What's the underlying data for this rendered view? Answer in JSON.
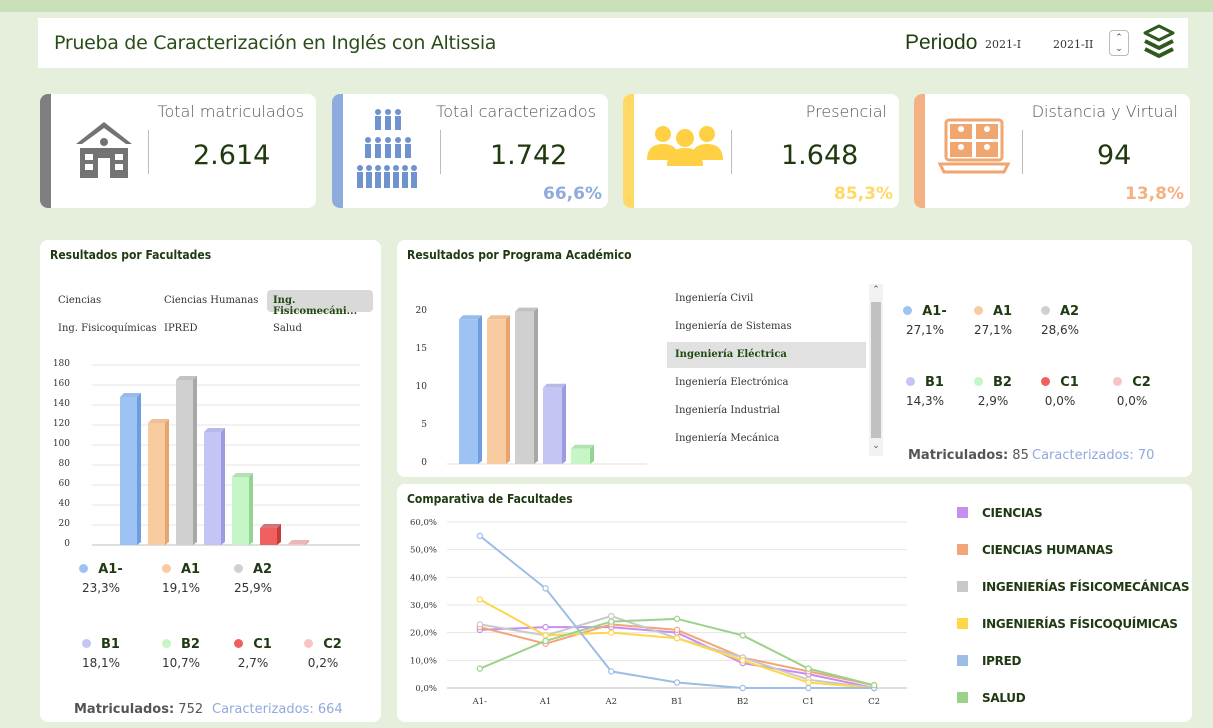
{
  "header": {
    "title": "Prueba de Caracterización en Inglés con Altissia",
    "periodo_label": "Periodo",
    "periods": [
      "2021-I",
      "2021-II"
    ],
    "spin": "▲▼"
  },
  "kpis": [
    {
      "label": "Total matriculados",
      "value": "2.614",
      "pct": "",
      "color": "#7f7f7f",
      "icon": "school-icon"
    },
    {
      "label": "Total caracterizados",
      "value": "1.742",
      "pct": "66,6%",
      "color": "#8faadc",
      "icon": "people-group-icon"
    },
    {
      "label": "Presencial",
      "value": "1.648",
      "pct": "85,3%",
      "color": "#ffd966",
      "icon": "people-icon"
    },
    {
      "label": "Distancia y Virtual",
      "value": "94",
      "pct": "13,8%",
      "color": "#f4b183",
      "icon": "laptop-video-icon"
    }
  ],
  "facultades": {
    "title": "Resultados por Facultades",
    "slicer": [
      "Ciencias",
      "Ciencias Humanas",
      "Ing. Fisicomecáni...",
      "Ing. Fisicoquímicas",
      "IPRED",
      "Salud"
    ],
    "selected": 2,
    "legend": [
      {
        "name": "A1-",
        "pct": "23,3%",
        "color": "#9dc3f5"
      },
      {
        "name": "A1",
        "pct": "19,1%",
        "color": "#f8cba0"
      },
      {
        "name": "A2",
        "pct": "25,9%",
        "color": "#d0d0d0"
      },
      {
        "name": "B1",
        "pct": "18,1%",
        "color": "#c5c5f5"
      },
      {
        "name": "B2",
        "pct": "10,7%",
        "color": "#c6f5c6"
      },
      {
        "name": "C1",
        "pct": "2,7%",
        "color": "#f06060"
      },
      {
        "name": "C2",
        "pct": "0,2%",
        "color": "#f9c3c3"
      }
    ],
    "matric_label": "Matriculados:",
    "matric": "752",
    "caract_label": "Caracterizados:",
    "caract": "664"
  },
  "programa": {
    "title": "Resultados por Programa Académico",
    "list": [
      "Ingeniería Civil",
      "Ingeniería de Sistemas",
      "Ingeniería Eléctrica",
      "Ingeniería Electrónica",
      "Ingeniería Industrial",
      "Ingeniería Mecánica"
    ],
    "selected": 2,
    "legend": [
      {
        "name": "A1-",
        "pct": "27,1%",
        "color": "#9dc3f5"
      },
      {
        "name": "A1",
        "pct": "27,1%",
        "color": "#f8cba0"
      },
      {
        "name": "A2",
        "pct": "28,6%",
        "color": "#d0d0d0"
      },
      {
        "name": "B1",
        "pct": "14,3%",
        "color": "#c5c5f5"
      },
      {
        "name": "B2",
        "pct": "2,9%",
        "color": "#c6f5c6"
      },
      {
        "name": "C1",
        "pct": "0,0%",
        "color": "#f06060"
      },
      {
        "name": "C2",
        "pct": "0,0%",
        "color": "#f9c3c3"
      }
    ],
    "matric_label": "Matriculados:",
    "matric": "85",
    "caract_label": "Caracterizados:",
    "caract": "70"
  },
  "comparativa": {
    "title": "Comparativa de Facultades"
  },
  "chart_data": [
    {
      "type": "bar",
      "title": "Resultados por Facultades",
      "categories": [
        "A1-",
        "A1",
        "A2",
        "B1",
        "B2",
        "C1",
        "C2"
      ],
      "values": [
        148,
        122,
        165,
        113,
        68,
        17,
        1
      ],
      "ylim": [
        0,
        180
      ],
      "yticks": [
        0,
        20,
        40,
        60,
        80,
        100,
        120,
        140,
        160,
        180
      ]
    },
    {
      "type": "bar",
      "title": "Resultados por Programa Académico",
      "categories": [
        "A1-",
        "A1",
        "A2",
        "B1",
        "B2",
        "C1",
        "C2"
      ],
      "values": [
        19,
        19,
        20,
        10,
        2,
        0,
        0
      ],
      "ylim": [
        0,
        21
      ],
      "yticks": [
        0,
        5,
        10,
        15,
        20
      ]
    },
    {
      "type": "line",
      "title": "Comparativa de Facultades",
      "categories": [
        "A1-",
        "A1",
        "A2",
        "B1",
        "B2",
        "C1",
        "C2"
      ],
      "ylim": [
        0,
        60
      ],
      "yticks": [
        "0,0%",
        "10,0%",
        "20,0%",
        "30,0%",
        "40,0%",
        "50,0%",
        "60,0%"
      ],
      "series": [
        {
          "name": "CIENCIAS",
          "color": "#c58ff0",
          "values": [
            21,
            22,
            22,
            20,
            9,
            5,
            0
          ]
        },
        {
          "name": "CIENCIAS HUMANAS",
          "color": "#f4a47a",
          "values": [
            22,
            16,
            23,
            21,
            11,
            6,
            1
          ]
        },
        {
          "name": "INGENIERÍAS FÍSICOMECÁNICAS",
          "color": "#c9c9c9",
          "values": [
            23,
            19,
            26,
            18,
            11,
            3,
            0
          ]
        },
        {
          "name": "INGENIERÍAS FÍSICOQUÍMICAS",
          "color": "#ffd54a",
          "values": [
            32,
            19,
            20,
            18,
            10,
            2,
            0
          ]
        },
        {
          "name": "IPRED",
          "color": "#9cbde6",
          "values": [
            55,
            36,
            6,
            2,
            0,
            0,
            0
          ]
        },
        {
          "name": "SALUD",
          "color": "#9cd18a",
          "values": [
            7,
            17,
            24,
            25,
            19,
            7,
            1
          ]
        }
      ]
    }
  ]
}
